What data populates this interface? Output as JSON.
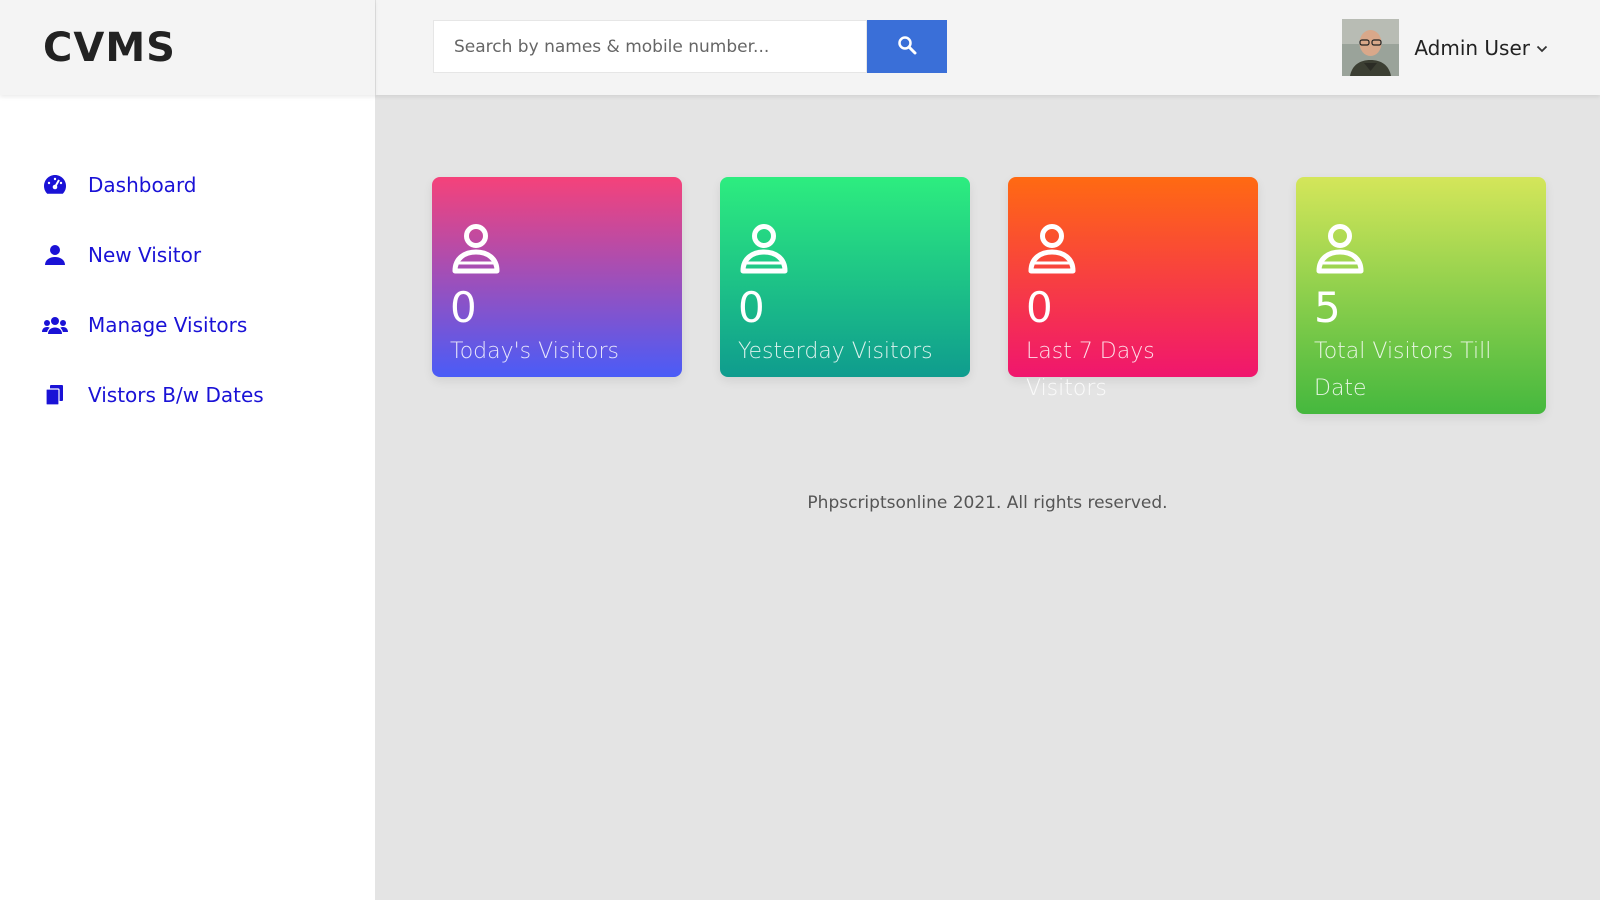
{
  "brand": {
    "name": "CVMS"
  },
  "sidebar": {
    "items": [
      {
        "label": "Dashboard",
        "icon": "dashboard-icon"
      },
      {
        "label": "New Visitor",
        "icon": "user-icon"
      },
      {
        "label": "Manage Visitors",
        "icon": "users-icon"
      },
      {
        "label": "Vistors B/w Dates",
        "icon": "documents-icon"
      }
    ]
  },
  "header": {
    "search": {
      "placeholder": "Search by names & mobile number...",
      "value": "",
      "icon": "search-icon"
    },
    "user": {
      "name": "Admin User",
      "icon": "chevron-down-icon"
    }
  },
  "stats": [
    {
      "count": "0",
      "title": "Today's Visitors"
    },
    {
      "count": "0",
      "title": "Yesterday Visitors"
    },
    {
      "count": "0",
      "title": "Last 7 Days Visitors"
    },
    {
      "count": "5",
      "title": "Total Visitors Till Date"
    }
  ],
  "footer": {
    "text": "Phpscriptsonline 2021. All rights reserved."
  },
  "colors": {
    "nav_link": "#1a12d6",
    "search_button": "#3a6fd8"
  }
}
